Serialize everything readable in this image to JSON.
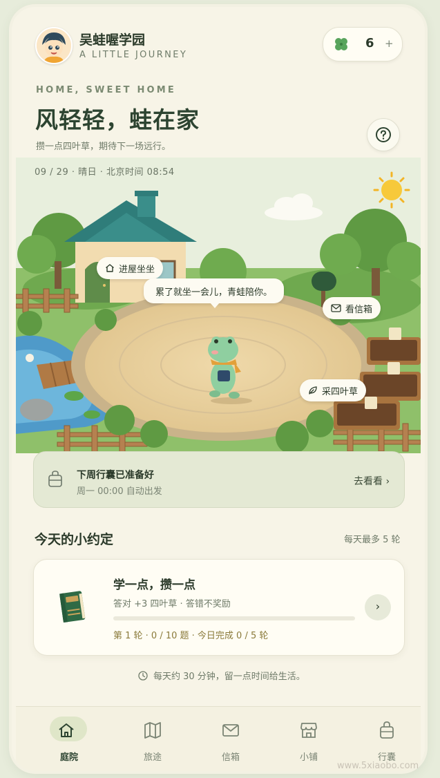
{
  "header": {
    "app_title": "吴蛙喔学园",
    "app_subtitle": "A LITTLE JOURNEY",
    "clover_count": "6",
    "plus": "+"
  },
  "hero": {
    "kicker": "HOME, SWEET HOME",
    "headline": "风轻轻，蛙在家",
    "tagline": "攒一点四叶草，期待下一场远行。",
    "date_line": "09 / 29 · 晴日 · 北京时间 08:54"
  },
  "scene": {
    "enter_house": "进屋坐坐",
    "speech": "累了就坐一会儿，青蛙陪你。",
    "mailbox": "看信箱",
    "pick_clover": "采四叶草"
  },
  "trip": {
    "title": "下周行囊已准备好",
    "subtitle": "周一 00:00 自动出发",
    "link": "去看看 ›"
  },
  "today": {
    "section_title": "今天的小约定",
    "section_note": "每天最多 5 轮",
    "task_title": "学一点，攒一点",
    "task_subtitle": "答对 +3 四叶草 · 答错不奖励",
    "task_progress_text": "第 1 轮 · 0 / 10 题 · 今日完成 0 / 5 轮",
    "task_progress_fraction": 0,
    "go": "›"
  },
  "footnote": "每天约 30 分钟，留一点时间给生活。",
  "tabs": [
    {
      "label": "庭院",
      "icon": "home-icon",
      "active": true
    },
    {
      "label": "旅途",
      "icon": "map-icon",
      "active": false
    },
    {
      "label": "信箱",
      "icon": "mail-icon",
      "active": false
    },
    {
      "label": "小铺",
      "icon": "shop-icon",
      "active": false
    },
    {
      "label": "行囊",
      "icon": "bag-icon",
      "active": false
    }
  ],
  "watermark": "www.5xiaobo.com",
  "colors": {
    "background": "#f7f4e7",
    "accent_green": "#2d4431",
    "card_green": "#e4e9d4",
    "progress_gold": "#8a7a3a"
  }
}
